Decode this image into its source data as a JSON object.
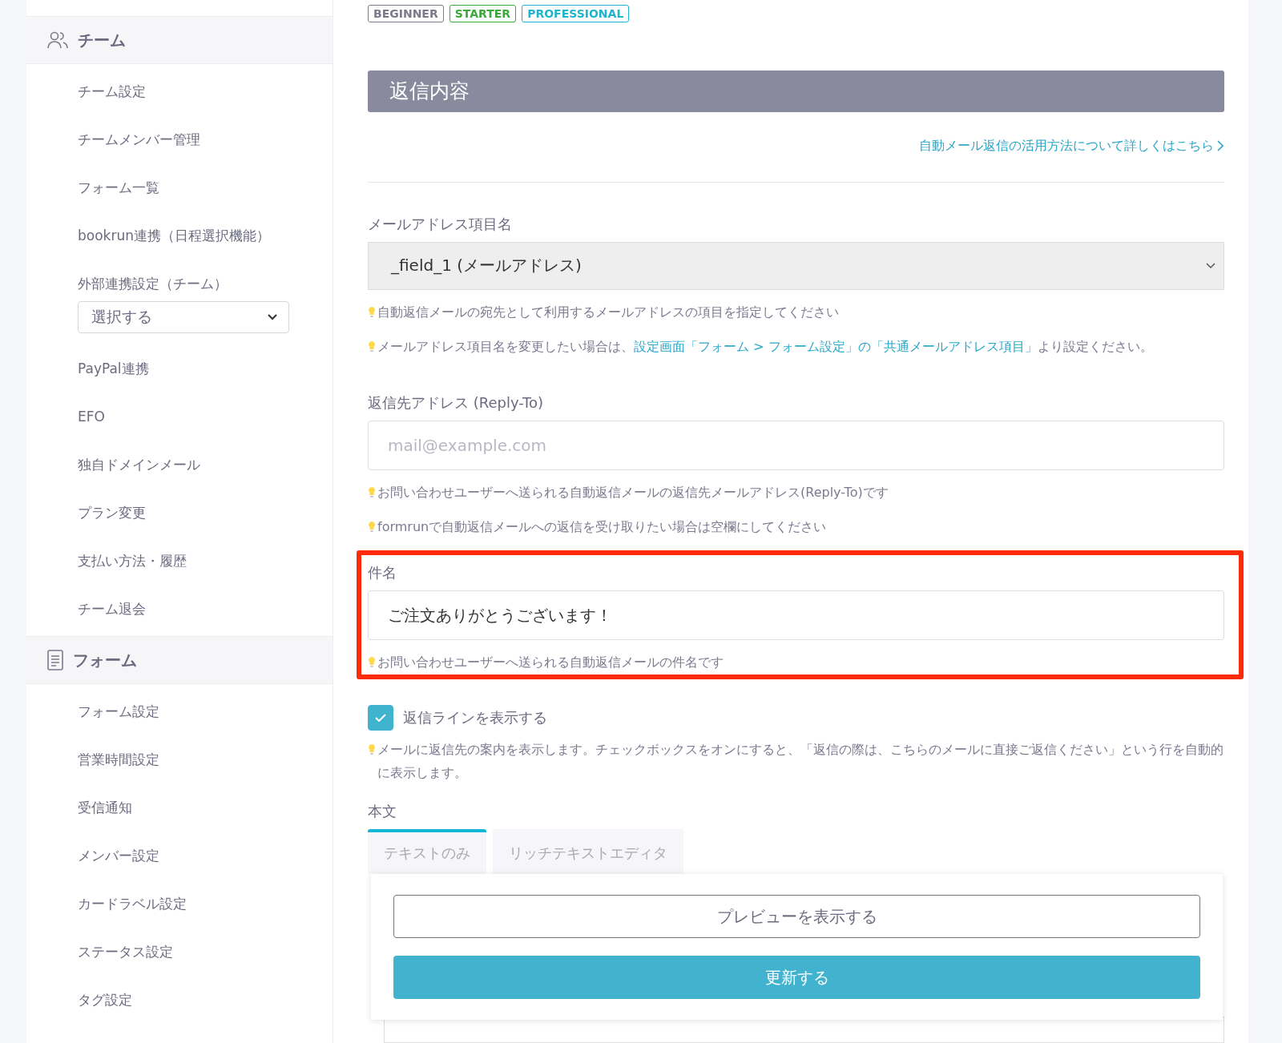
{
  "sidebar": {
    "sections": [
      {
        "title": "チーム",
        "items": [
          {
            "kind": "link",
            "label": "チーム設定"
          },
          {
            "kind": "link",
            "label": "チームメンバー管理"
          },
          {
            "kind": "link",
            "label": "フォーム一覧"
          },
          {
            "kind": "link",
            "label": "bookrun連携（日程選択機能）"
          },
          {
            "kind": "link",
            "label": "外部連携設定（チーム）"
          },
          {
            "kind": "select",
            "value": "選択する"
          },
          {
            "kind": "link",
            "label": "PayPal連携"
          },
          {
            "kind": "link",
            "label": "EFO"
          },
          {
            "kind": "link",
            "label": "独自ドメインメール"
          },
          {
            "kind": "link",
            "label": "プラン変更"
          },
          {
            "kind": "link",
            "label": "支払い方法・履歴"
          },
          {
            "kind": "link",
            "label": "チーム退会"
          }
        ]
      },
      {
        "title": "フォーム",
        "items": [
          {
            "kind": "link",
            "label": "フォーム設定"
          },
          {
            "kind": "link",
            "label": "営業時間設定"
          },
          {
            "kind": "link",
            "label": "受信通知"
          },
          {
            "kind": "link",
            "label": "メンバー設定"
          },
          {
            "kind": "link",
            "label": "カードラベル設定"
          },
          {
            "kind": "link",
            "label": "ステータス設定"
          },
          {
            "kind": "link",
            "label": "タグ設定"
          }
        ]
      }
    ]
  },
  "plan_badges": [
    {
      "label": "BEGINNER",
      "color": "#7a7a8c"
    },
    {
      "label": "STARTER",
      "color": "#3aa83a"
    },
    {
      "label": "PROFESSIONAL",
      "color": "#1fb5cc"
    }
  ],
  "section_title": "返信内容",
  "help_link": "自動メール返信の活用方法について詳しくはこちら",
  "fields": [
    {
      "kind": "select",
      "label": "メールアドレス項目名",
      "value": "_field_1 (メールアドレス)",
      "highlighted": false,
      "hints": [
        {
          "kind": "plain",
          "text": "自動返信メールの宛先として利用するメールアドレスの項目を指定してください"
        },
        {
          "kind": "link",
          "before": "メールアドレス項目名を変更したい場合は、",
          "link": "設定画面「フォーム > フォーム設定」の「共通メールアドレス項目」",
          "after": "より設定ください。"
        }
      ]
    },
    {
      "kind": "input",
      "label": "返信先アドレス (Reply-To)",
      "placeholder": "mail@example.com",
      "highlighted": false,
      "hints": [
        {
          "kind": "plain",
          "text": "お問い合わせユーザーへ送られる自動返信メールの返信先メールアドレス(Reply-To)です"
        },
        {
          "kind": "plain",
          "text": "formrunで自動返信メールへの返信を受け取りたい場合は空欄にしてください"
        }
      ]
    },
    {
      "kind": "input",
      "label": "件名",
      "value": "ご注文ありがとうございます！",
      "highlighted": true,
      "hints": [
        {
          "kind": "plain",
          "text": "お問い合わせユーザーへ送られる自動返信メールの件名です"
        }
      ]
    }
  ],
  "reply_line": {
    "label": "返信ラインを表示する",
    "checked": true,
    "hint": "メールに返信先の案内を表示します。チェックボックスをオンにすると、「返信の際は、こちらのメールに直接ご返信ください」という行を自動的に表示します。"
  },
  "body": {
    "label": "本文",
    "tabs": [
      {
        "label": "テキストのみ",
        "selected": true
      },
      {
        "label": "リッチテキストエディタ",
        "selected": false
      }
    ]
  },
  "buttons": [
    {
      "kind": "outline",
      "label": "プレビューを表示する"
    },
    {
      "kind": "primary",
      "label": "更新する"
    }
  ]
}
